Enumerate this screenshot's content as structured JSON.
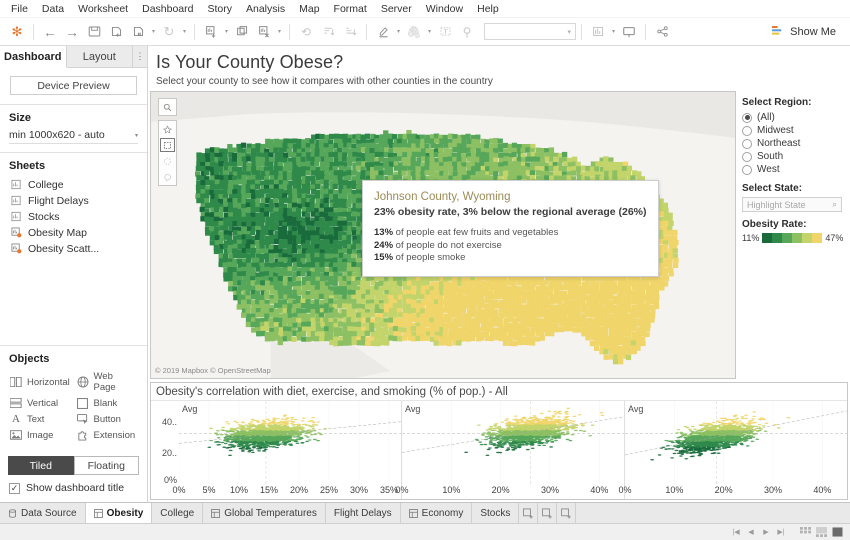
{
  "menu": {
    "items": [
      "File",
      "Data",
      "Worksheet",
      "Dashboard",
      "Story",
      "Analysis",
      "Map",
      "Format",
      "Server",
      "Window",
      "Help"
    ]
  },
  "toolbar": {
    "show_me_label": "Show Me",
    "icons": [
      {
        "name": "tableau-logo-icon",
        "glyph": "✻"
      },
      {
        "name": "back-icon",
        "glyph": "←"
      },
      {
        "name": "forward-icon",
        "glyph": "→"
      },
      {
        "name": "save-icon",
        "glyph": "▤"
      },
      {
        "name": "add-data-source-icon",
        "glyph": "⎙"
      },
      {
        "name": "pause-updates-icon",
        "glyph": "⎙"
      },
      {
        "name": "refresh-icon",
        "glyph": "↻"
      },
      {
        "name": "new-worksheet-icon",
        "glyph": "▥"
      },
      {
        "name": "duplicate-sheet-icon",
        "glyph": "❏"
      },
      {
        "name": "clear-sheet-icon",
        "glyph": "▥"
      },
      {
        "name": "undo-clear-icon",
        "glyph": "⟲"
      },
      {
        "name": "sort-ascending-icon",
        "glyph": "⇟"
      },
      {
        "name": "sort-descending-icon",
        "glyph": "⇞"
      },
      {
        "name": "highlight-icon",
        "glyph": "🖉"
      },
      {
        "name": "attachment-icon",
        "glyph": "🖇"
      },
      {
        "name": "text-box-icon",
        "glyph": "T"
      },
      {
        "name": "fixed-axis-icon",
        "glyph": "⚲"
      },
      {
        "name": "fit-selector-icon",
        "glyph": "▦"
      },
      {
        "name": "presentation-mode-icon",
        "glyph": "🖵"
      },
      {
        "name": "share-icon",
        "glyph": "⦿"
      }
    ],
    "fit_placeholder": ""
  },
  "left_panel": {
    "tabs": [
      {
        "label": "Dashboard",
        "active": true
      },
      {
        "label": "Layout",
        "active": false
      }
    ],
    "device_preview_label": "Device Preview",
    "size": {
      "heading": "Size",
      "value": "min 1000x620 - auto"
    },
    "sheets": {
      "heading": "Sheets",
      "items": [
        {
          "label": "College",
          "used": false
        },
        {
          "label": "Flight Delays",
          "used": false
        },
        {
          "label": "Stocks",
          "used": false
        },
        {
          "label": "Obesity Map",
          "used": true
        },
        {
          "label": "Obesity Scatt...",
          "used": true
        }
      ]
    },
    "objects": {
      "heading": "Objects",
      "items": [
        {
          "label": "Horizontal",
          "icon": "horizontal-container-icon"
        },
        {
          "label": "Web Page",
          "icon": "globe-icon"
        },
        {
          "label": "Vertical",
          "icon": "vertical-container-icon"
        },
        {
          "label": "Blank",
          "icon": "blank-square-icon"
        },
        {
          "label": "Text",
          "icon": "text-icon"
        },
        {
          "label": "Button",
          "icon": "button-icon"
        },
        {
          "label": "Image",
          "icon": "image-icon"
        },
        {
          "label": "Extension",
          "icon": "extension-icon"
        }
      ]
    },
    "tiled_label": "Tiled",
    "floating_label": "Floating",
    "tiled_active": true,
    "show_title_label": "Show dashboard title",
    "show_title_checked": true
  },
  "dashboard": {
    "title": "Is Your County Obese?",
    "subtitle": "Select your county to see how it compares with other counties in the country"
  },
  "map": {
    "attribution": "© 2019 Mapbox © OpenStreetMap",
    "tools": [
      {
        "name": "map-search-icon",
        "glyph": "⌕",
        "state": "normal"
      },
      {
        "name": "map-pin-icon",
        "glyph": "⚲",
        "state": "normal"
      },
      {
        "name": "rectangle-select-icon",
        "glyph": "▢",
        "state": "selected"
      },
      {
        "name": "radial-select-icon",
        "glyph": "◯",
        "state": "faded"
      },
      {
        "name": "lasso-select-icon",
        "glyph": "◠",
        "state": "faded"
      }
    ],
    "tooltip": {
      "county": "Johnson County, Wyoming",
      "headline_parts": {
        "rate": "23%",
        "text_mid": " obesity rate, ",
        "diff": "3%",
        "text_end": " below the regional average (26%)"
      },
      "headline": "23% obesity rate, 3% below the regional average (26%)",
      "stats": [
        {
          "value": "13%",
          "label": " of people eat few fruits and vegetables"
        },
        {
          "value": "24%",
          "label": " of people do not exercise"
        },
        {
          "value": "15%",
          "label": " of people smoke"
        }
      ]
    }
  },
  "filters": {
    "region": {
      "heading": "Select Region:",
      "options": [
        {
          "label": "(All)",
          "selected": true
        },
        {
          "label": "Midwest",
          "selected": false
        },
        {
          "label": "Northeast",
          "selected": false
        },
        {
          "label": "South",
          "selected": false
        },
        {
          "label": "West",
          "selected": false
        }
      ]
    },
    "state": {
      "heading": "Select State:",
      "placeholder": "Highlight State",
      "value": ""
    },
    "legend": {
      "heading": "Obesity Rate:",
      "min": "11%",
      "max": "47%",
      "colors": [
        "#1a6b3c",
        "#2f8a4a",
        "#57a75a",
        "#8cc063",
        "#c2d46a",
        "#f0d56a"
      ]
    }
  },
  "chart_data": {
    "type": "scatter",
    "title": "Obesity's correlation with diet, exercise, and smoking (% of pop.) - All",
    "ylabel": "",
    "yticks": [
      "40..",
      "20..",
      "0%"
    ],
    "ylim": [
      0,
      50
    ],
    "avg_label": "Avg",
    "grid": true,
    "panels": [
      {
        "name": "diet",
        "xlabel": "",
        "xticks": [
          "0%",
          "5%",
          "10%",
          "15%",
          "20%",
          "25%",
          "30%",
          "35%"
        ],
        "xlim": [
          0,
          37
        ],
        "x_mean": 14.5,
        "y_mean": 30.5,
        "trend": {
          "x0": 0,
          "y0": 24.5,
          "x1": 37,
          "y1": 37.5
        },
        "n_points": 3100
      },
      {
        "name": "exercise",
        "xlabel": "",
        "xticks": [
          "0%",
          "10%",
          "20%",
          "30%",
          "40%"
        ],
        "xlim": [
          0,
          45
        ],
        "x_mean": 26.0,
        "y_mean": 30.5,
        "trend": {
          "x0": 0,
          "y0": 19.0,
          "x1": 45,
          "y1": 40.5
        },
        "n_points": 3100
      },
      {
        "name": "smoking",
        "xlabel": "",
        "xticks": [
          "0%",
          "10%",
          "20%",
          "30%",
          "40%"
        ],
        "xlim": [
          0,
          45
        ],
        "x_mean": 18.5,
        "y_mean": 30.5,
        "trend": {
          "x0": 0,
          "y0": 17.5,
          "x1": 45,
          "y1": 44.0
        },
        "n_points": 3100
      }
    ]
  },
  "bottom_tabs": {
    "items": [
      {
        "label": "Data Source",
        "icon": "data-source-icon",
        "active": false
      },
      {
        "label": "Obesity",
        "icon": "dashboard-icon",
        "active": true
      },
      {
        "label": "College",
        "icon": "",
        "active": false
      },
      {
        "label": "Global Temperatures",
        "icon": "dashboard-icon",
        "active": false
      },
      {
        "label": "Flight Delays",
        "icon": "",
        "active": false
      },
      {
        "label": "Economy",
        "icon": "dashboard-icon",
        "active": false
      },
      {
        "label": "Stocks",
        "icon": "",
        "active": false
      }
    ],
    "add_buttons": [
      {
        "name": "new-worksheet-button",
        "glyph": "▣"
      },
      {
        "name": "new-dashboard-button",
        "glyph": "▦"
      },
      {
        "name": "new-story-button",
        "glyph": "▤"
      }
    ]
  },
  "statusbar": {
    "nav": [
      {
        "name": "first-page-button",
        "glyph": "|◀"
      },
      {
        "name": "previous-page-button",
        "glyph": "◀"
      },
      {
        "name": "next-page-button",
        "glyph": "▶"
      },
      {
        "name": "last-page-button",
        "glyph": "▶|"
      }
    ],
    "views": [
      {
        "name": "grid-view-button",
        "glyph": "▦"
      },
      {
        "name": "filmstrip-view-button",
        "glyph": "▭"
      },
      {
        "name": "sheet-view-button",
        "glyph": "■"
      }
    ]
  }
}
